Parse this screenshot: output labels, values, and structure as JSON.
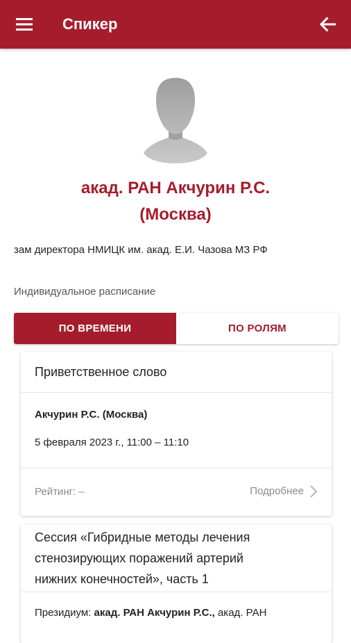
{
  "appbar": {
    "title": "Спикер",
    "menu_icon": "menu-icon",
    "back_icon": "arrow-back-icon",
    "color": "#a51d2c"
  },
  "speaker": {
    "name_line1": "акад. РАН Акчурин Р.С.",
    "name_line2": "(Москва)",
    "position": "зам директора НМИЦК им. акад. Е.И. Чазова МЗ РФ",
    "avatar_icon": "avatar-placeholder-icon"
  },
  "schedule": {
    "label": "Индивидуальное расписание",
    "tabs": [
      {
        "label": "ПО ВРЕМЕНИ",
        "active": true
      },
      {
        "label": "ПО РОЛЯМ",
        "active": false
      }
    ]
  },
  "events": [
    {
      "title": "Приветственное слово",
      "speaker": "Акчурин Р.С. (Москва)",
      "time": "5 февраля 2023 г., 11:00 – 11:10",
      "rating": "Рейтинг: –",
      "more": "Подробнее"
    },
    {
      "title_line1": "Сессия «Гибридные методы лечения",
      "title_line2": "стенозирующих поражений артерий",
      "title_line3": "нижних конечностей», часть 1",
      "presidium_label": "Президиум:",
      "presidium_bold": "акад. РАН Акчурин Р.С.,",
      "presidium_rest": "акад. РАН"
    }
  ]
}
